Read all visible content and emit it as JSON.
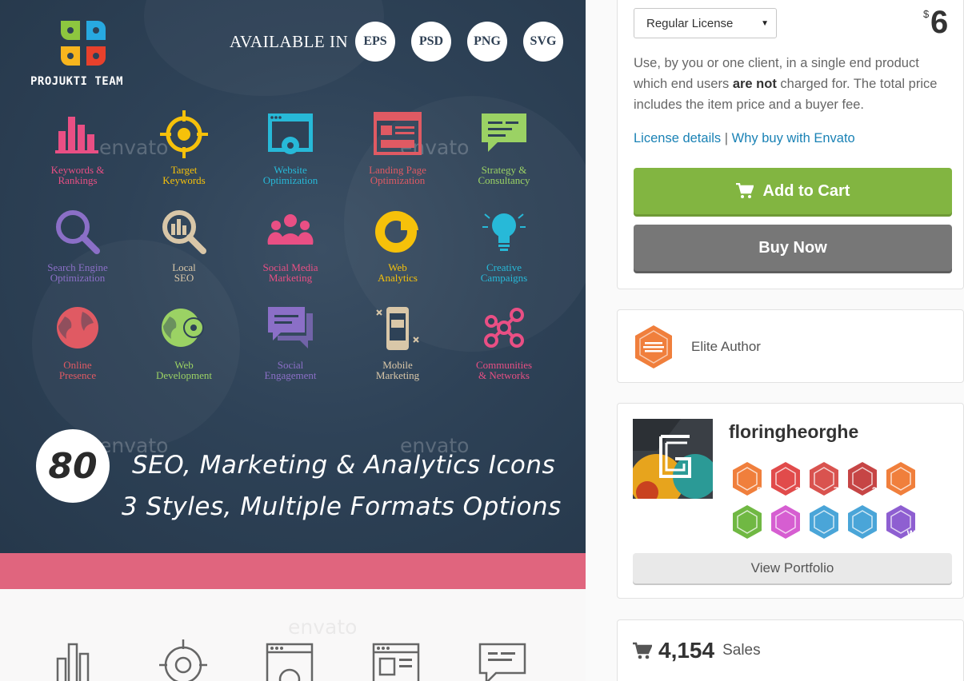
{
  "banner": {
    "brand_name": "PROJUKTI TEAM",
    "available_label": "AVAILABLE IN",
    "formats": [
      "EPS",
      "PSD",
      "PNG",
      "SVG"
    ],
    "watermark": "envato",
    "count": "80",
    "headline_1": "SEO, Marketing & Analytics Icons",
    "headline_2": "3 Styles, Multiple Formats Options",
    "icons": [
      {
        "label": "Keywords &\nRankings",
        "color": "#e94f84",
        "icon": "bar-chart-icon"
      },
      {
        "label": "Target\nKeywords",
        "color": "#f6c10a",
        "icon": "target-icon"
      },
      {
        "label": "Website\nOptimization",
        "color": "#27b9d8",
        "icon": "website-gear-icon"
      },
      {
        "label": "Landing Page\nOptimization",
        "color": "#e05a63",
        "icon": "landing-page-icon"
      },
      {
        "label": "Strategy &\nConsultancy",
        "color": "#9bd264",
        "icon": "chat-bubble-icon"
      },
      {
        "label": "Search Engine\nOptimization",
        "color": "#8b6fc7",
        "icon": "magnifier-icon"
      },
      {
        "label": "Local\nSEO",
        "color": "#d9c7a8",
        "icon": "local-search-icon"
      },
      {
        "label": "Social Media\nMarketing",
        "color": "#e94f84",
        "icon": "people-icon"
      },
      {
        "label": "Web\nAnalytics",
        "color": "#f6c10a",
        "icon": "donut-chart-icon"
      },
      {
        "label": "Creative\nCampaigns",
        "color": "#27b9d8",
        "icon": "lightbulb-icon"
      },
      {
        "label": "Online\nPresence",
        "color": "#e05a63",
        "icon": "globe-icon"
      },
      {
        "label": "Web\nDevelopment",
        "color": "#9bd264",
        "icon": "globe-gear-icon"
      },
      {
        "label": "Social\nEngagement",
        "color": "#8b6fc7",
        "icon": "comments-icon"
      },
      {
        "label": "Mobile\nMarketing",
        "color": "#d9c7a8",
        "icon": "mobile-icon"
      },
      {
        "label": "Communities\n& Networks",
        "color": "#e94f84",
        "icon": "network-icon"
      }
    ]
  },
  "purchase": {
    "license_selected": "Regular License",
    "currency": "$",
    "price": "6",
    "desc_part1": "Use, by you or one client, in a single end product which end users ",
    "desc_bold": "are not",
    "desc_part2": " charged for. The total price includes the item price and a buyer fee.",
    "link_license": "License details",
    "link_separator": "|",
    "link_why": "Why buy with Envato",
    "add_to_cart": "Add to Cart",
    "buy_now": "Buy Now"
  },
  "author": {
    "elite_label": "Elite Author",
    "username": "floringheorghe",
    "view_portfolio": "View Portfolio",
    "badges": [
      {
        "name": "years-badge",
        "color": "#f07f3c",
        "text": "5"
      },
      {
        "name": "referrer-badge",
        "color": "#e14b4b",
        "text": "2"
      },
      {
        "name": "paw-badge",
        "color": "#d9534f",
        "text": "7"
      },
      {
        "name": "sc-badge",
        "color": "#c64545",
        "text": "2"
      },
      {
        "name": "elite-badge",
        "color": "#f07f3c",
        "text": ""
      },
      {
        "name": "bag-badge",
        "color": "#70b843",
        "text": ""
      },
      {
        "name": "diamond-badge",
        "color": "#d65ed1",
        "text": ""
      },
      {
        "name": "collection-badge",
        "color": "#4aa5d8",
        "text": ""
      },
      {
        "name": "bolt-badge",
        "color": "#4aa5d8",
        "text": ""
      },
      {
        "name": "rocket-badge",
        "color": "#8e5fd1",
        "text": "W"
      }
    ]
  },
  "sales": {
    "count": "4,154",
    "label": "Sales"
  }
}
